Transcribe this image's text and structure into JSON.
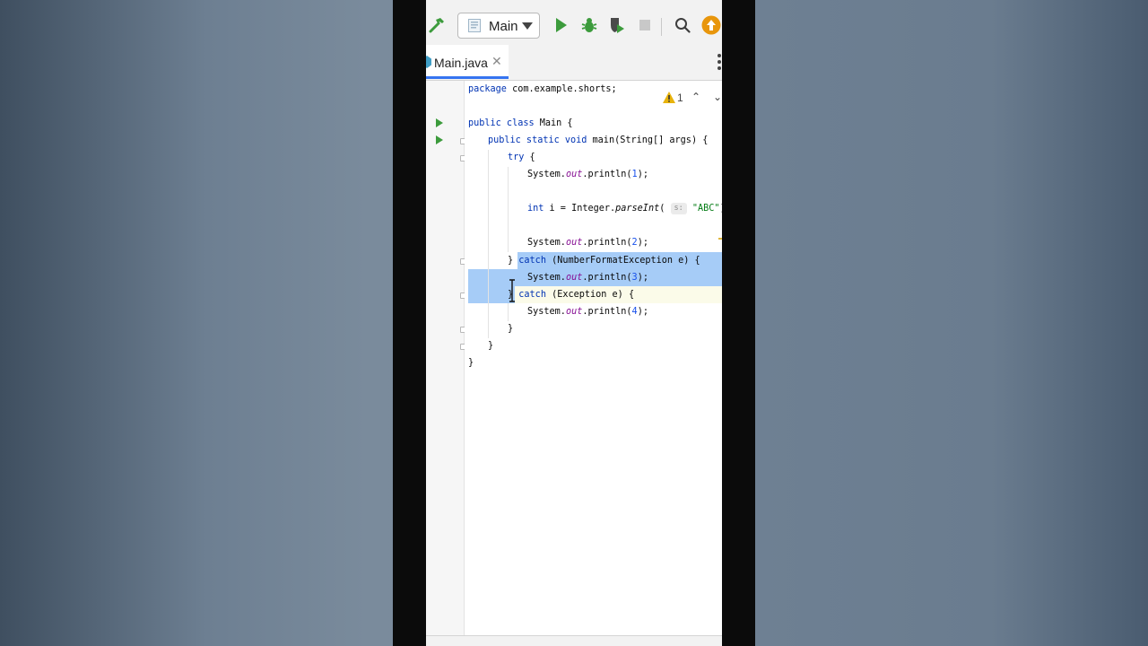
{
  "toolbar": {
    "build_icon": "hammer-icon",
    "run_config_label": "Main",
    "run_icon": "play-icon",
    "debug_icon": "bug-icon",
    "coverage_icon": "shield-run-icon",
    "stop_icon": "stop-icon",
    "search_icon": "search-icon",
    "update_icon": "update-arrow-icon",
    "accent_green": "#3c9b3c",
    "accent_orange": "#e8960c"
  },
  "tabs": [
    {
      "label": "Main.java",
      "close": "✕",
      "active": true
    }
  ],
  "inspections": {
    "warning_count": "1"
  },
  "code": {
    "l1_kw": "package",
    "l1_rest": " com.example.shorts;",
    "l2_kw": "public class",
    "l2_rest": " Main {",
    "l3_kw": "public static void",
    "l3_rest": " main(String[] args) {",
    "l4_kw": "try",
    "l4_rest": " {",
    "l5_a": "System.",
    "l5_fld": "out",
    "l5_b": ".println(",
    "l5_num": "1",
    "l5_c": ");",
    "l6_kw": "int",
    "l6_a": " i = Integer.",
    "l6_method": "parseInt",
    "l6_b": "( ",
    "l6_hint": "s:",
    "l6_str": "\"ABC\"",
    "l6_c": ");",
    "l7_a": "System.",
    "l7_fld": "out",
    "l7_b": ".println(",
    "l7_num": "2",
    "l7_c": ");",
    "l8_brace": "}",
    "l8_kw": "catch",
    "l8_rest": " (NumberFormatException e) {",
    "l9_a": "System.",
    "l9_fld": "out",
    "l9_b": ".println(",
    "l9_num": "3",
    "l9_c": ");",
    "l10_brace": "}",
    "l10_kw": "catch",
    "l10_rest": " (Exception e) {",
    "l11_a": "System.",
    "l11_fld": "out",
    "l11_b": ".println(",
    "l11_num": "4",
    "l11_c": ");",
    "l12": "}",
    "l13": "}",
    "l14": "}"
  }
}
